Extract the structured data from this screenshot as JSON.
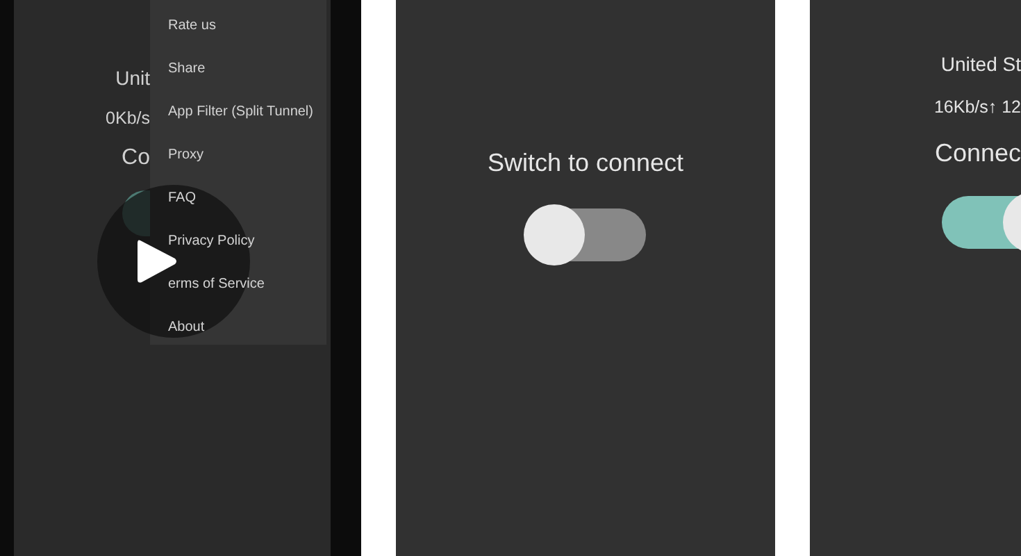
{
  "screens": [
    {
      "location": "Unit",
      "speed": "0Kb/s",
      "status": "Co",
      "toggle": {
        "on": true
      },
      "menu": [
        "Rate us",
        "Share",
        "App Filter (Split Tunnel)",
        "Proxy",
        "FAQ",
        "Privacy Policy",
        "erms of Service",
        "About"
      ]
    },
    {
      "status": "Switch to connect",
      "toggle": {
        "on": false
      }
    },
    {
      "location": "United St",
      "speed": "16Kb/s↑ 12",
      "status": "Connec",
      "toggle": {
        "on": true
      }
    }
  ]
}
